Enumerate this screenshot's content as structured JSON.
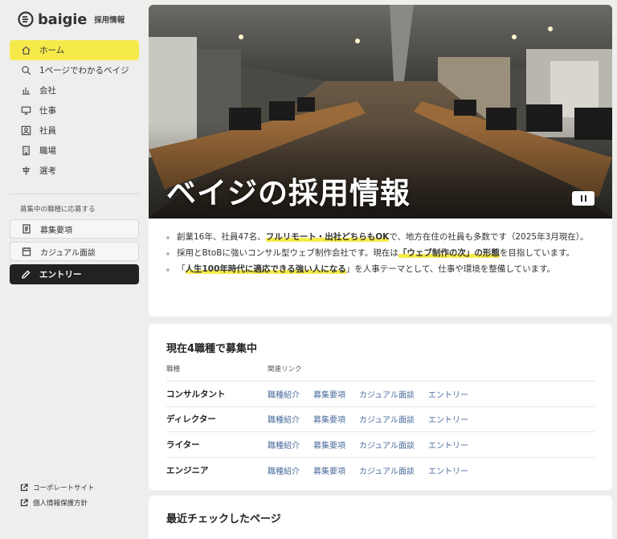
{
  "brand": {
    "name": "baigie",
    "sub": "採用情報"
  },
  "nav": [
    {
      "label": "ホーム",
      "icon": "home-icon",
      "active": true
    },
    {
      "label": "1ページでわかるベイジ",
      "icon": "search-icon"
    },
    {
      "label": "会社",
      "icon": "chart-icon"
    },
    {
      "label": "仕事",
      "icon": "monitor-icon"
    },
    {
      "label": "社員",
      "icon": "person-icon"
    },
    {
      "label": "職場",
      "icon": "building-icon"
    },
    {
      "label": "選考",
      "icon": "flow-icon"
    }
  ],
  "apply": {
    "section_label": "募集中の職種に応募する",
    "requirements": "募集要項",
    "casual": "カジュアル面談",
    "entry": "エントリー"
  },
  "footer": {
    "corporate": "コーポレートサイト",
    "privacy": "個人情報保護方針"
  },
  "hero": {
    "title": "ベイジの採用情報"
  },
  "intro": {
    "item1": {
      "a": "創業16年、社員47名、",
      "hl": "フルリモート・出社どちらもOK",
      "b": "で、地方在住の社員も多数です（2025年3月現在）。"
    },
    "item2": {
      "a": "採用とBtoBに強いコンサル型ウェブ制作会社です。現在は",
      "hl": "「ウェブ制作の次」の形態",
      "b": "を目指しています。"
    },
    "item3": {
      "a": "「",
      "hl": "人生100年時代に適応できる強い人になる",
      "b": "」を人事テーマとして、仕事や環境を整備しています。"
    }
  },
  "jobs": {
    "title": "現在4職種で募集中",
    "col_role": "職種",
    "col_links": "関連リンク",
    "rows": [
      {
        "name": "コンサルタント",
        "l1": "職種紹介",
        "l2": "募集要項",
        "l3": "カジュアル面談",
        "l4": "エントリー"
      },
      {
        "name": "ディレクター",
        "l1": "職種紹介",
        "l2": "募集要項",
        "l3": "カジュアル面談",
        "l4": "エントリー"
      },
      {
        "name": "ライター",
        "l1": "職種紹介",
        "l2": "募集要項",
        "l3": "カジュアル面談",
        "l4": "エントリー"
      },
      {
        "name": "エンジニア",
        "l1": "職種紹介",
        "l2": "募集要項",
        "l3": "カジュアル面談",
        "l4": "エントリー"
      }
    ]
  },
  "recent": {
    "title": "最近チェックしたページ"
  },
  "colors": {
    "accent": "#f6ea4a",
    "link": "#4a6c9b",
    "dark": "#222222"
  }
}
